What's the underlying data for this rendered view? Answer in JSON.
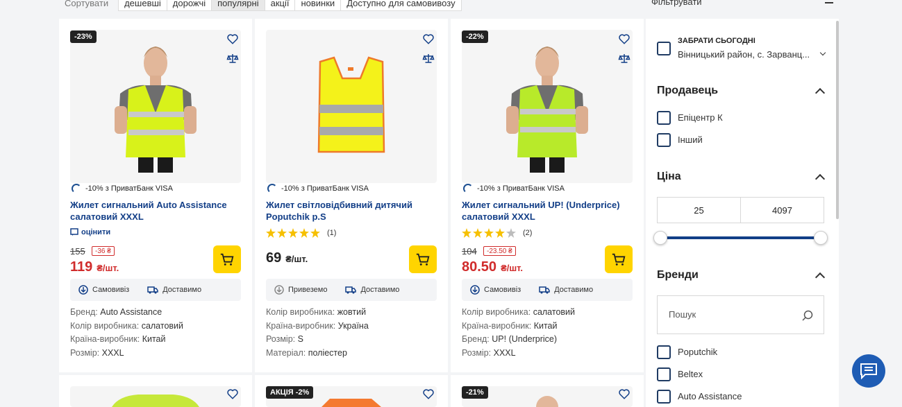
{
  "sort": {
    "label": "Сортувати",
    "options": [
      "дешевші",
      "дорожчі",
      "популярні",
      "акції",
      "новинки",
      "Доступно для самовивозу"
    ],
    "active_index": 2
  },
  "filter_header": {
    "label": "Фільтрувати"
  },
  "products": [
    {
      "badge": "-23%",
      "bank_promo": "-10% з ПриватБанк VISA",
      "title": "Жилет сигнальний Auto Assistance салатовий XXXL",
      "rate_label": "оцінити",
      "old_price": "155",
      "discount": "-36 ₴",
      "price": "119",
      "unit": "₴/шт.",
      "delivery": [
        "Самовивіз",
        "Доставимо"
      ],
      "specs": [
        {
          "k": "Бренд:",
          "v": "Auto Assistance"
        },
        {
          "k": "Колір виробника:",
          "v": "салатовий"
        },
        {
          "k": "Країна-виробник:",
          "v": "Китай"
        },
        {
          "k": "Розмір:",
          "v": "XXXL"
        }
      ],
      "vest_color": "#d8f21a"
    },
    {
      "bank_promo": "-10% з ПриватБанк VISA",
      "title": "Жилет світловідбивний дитячий Poputchik p.S",
      "rating": 5,
      "reviews": "(1)",
      "price": "69",
      "unit": "₴/шт.",
      "delivery": [
        "Привеземо",
        "Доставимо"
      ],
      "specs": [
        {
          "k": "Колір виробника:",
          "v": "жовтий"
        },
        {
          "k": "Країна-виробник:",
          "v": "Україна"
        },
        {
          "k": "Розмір:",
          "v": "S"
        },
        {
          "k": "Матеріал:",
          "v": "поліестер"
        }
      ],
      "vest_color": "#f4f21a"
    },
    {
      "badge": "-22%",
      "bank_promo": "-10% з ПриватБанк VISA",
      "title": "Жилет сигнальний UP! (Underprice) салатовий XXXL",
      "rating": 4,
      "reviews": "(2)",
      "old_price": "104",
      "discount": "-23.50 ₴",
      "price": "80.50",
      "unit": "₴/шт.",
      "delivery": [
        "Самовивіз",
        "Доставимо"
      ],
      "specs": [
        {
          "k": "Колір виробника:",
          "v": "салатовий"
        },
        {
          "k": "Країна-виробник:",
          "v": "Китай"
        },
        {
          "k": "Бренд:",
          "v": "UP! (Underprice)"
        },
        {
          "k": "Розмір:",
          "v": "XXXL"
        }
      ],
      "vest_color": "#b8ea2a"
    }
  ],
  "second_row": [
    {
      "badge": ""
    },
    {
      "badge": "АКЦІЯ -2%"
    },
    {
      "badge": "-21%"
    }
  ],
  "sidebar": {
    "pickup": {
      "title": "ЗАБРАТИ СЬОГОДНІ",
      "location": "Вінницький район, с. Зарванц..."
    },
    "seller": {
      "title": "Продавець",
      "options": [
        "Епіцентр К",
        "Інший"
      ]
    },
    "price": {
      "title": "Ціна",
      "min": "25",
      "max": "4097"
    },
    "brands": {
      "title": "Бренди",
      "search_placeholder": "Пошук",
      "options": [
        "Poputchik",
        "Beltex",
        "Auto Assistance"
      ]
    }
  },
  "colors": {
    "accent_blue": "#123e87",
    "cart_yellow": "#ffd400",
    "sale_red": "#d02b2b"
  }
}
